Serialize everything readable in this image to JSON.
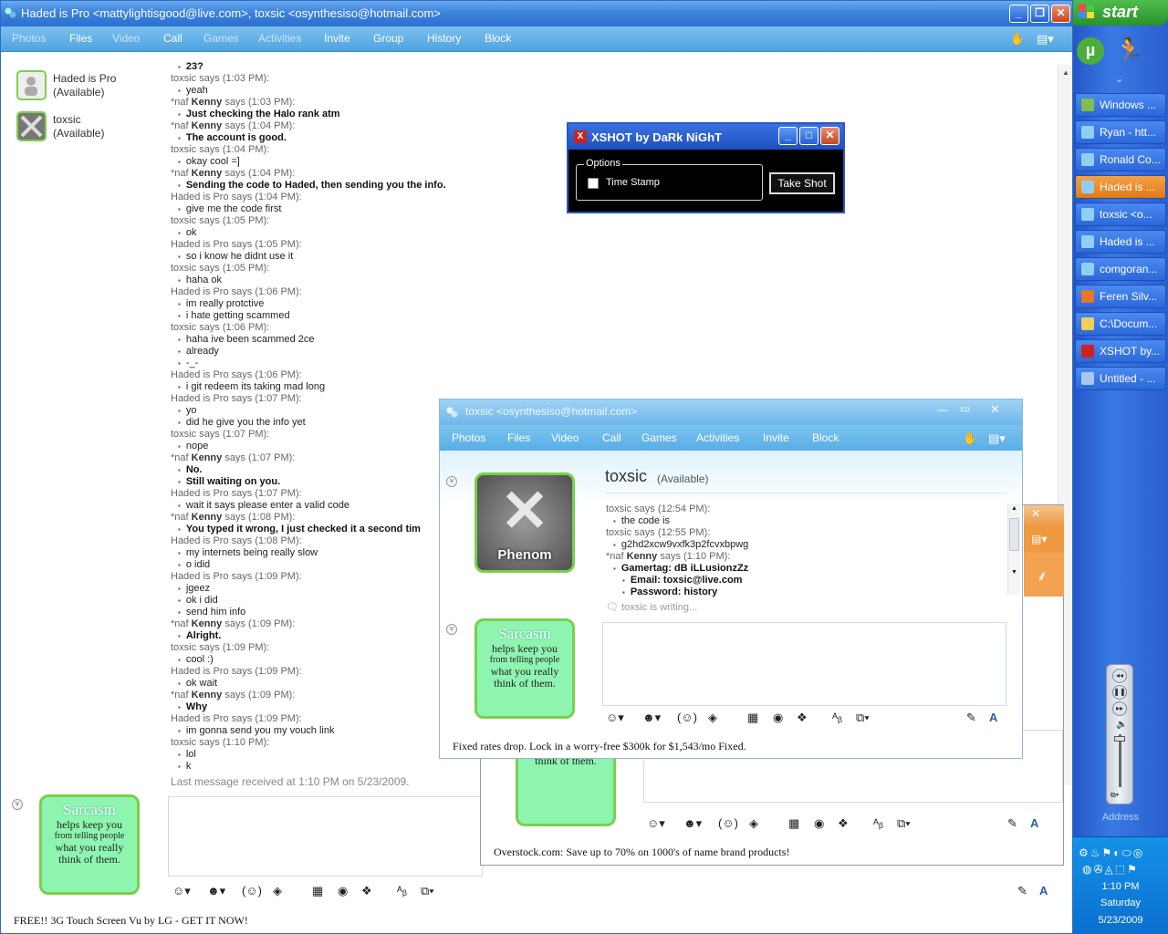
{
  "main_window": {
    "title": "Haded is Pro <mattylightisgood@live.com>, toxsic <osynthesiso@hotmail.com>",
    "menu": [
      {
        "label": "Photos",
        "dim": true
      },
      {
        "label": "Files",
        "dim": false
      },
      {
        "label": "Video",
        "dim": true
      },
      {
        "label": "Call",
        "dim": false
      },
      {
        "label": "Games",
        "dim": true
      },
      {
        "label": "Activities",
        "dim": true
      },
      {
        "label": "Invite",
        "dim": false
      },
      {
        "label": "Group",
        "dim": false
      },
      {
        "label": "History",
        "dim": false
      },
      {
        "label": "Block",
        "dim": false
      }
    ],
    "contacts": [
      {
        "name": "Haded is Pro",
        "status": "(Available)"
      },
      {
        "name": "toxsic",
        "status": "(Available)"
      }
    ],
    "messages": [
      {
        "lines": [
          "23?"
        ],
        "bold": true
      },
      {
        "sender": "toxsic",
        "prefix": "",
        "time": "says (1:03 PM):",
        "lines": [
          "yeah"
        ]
      },
      {
        "sender": "Kenny",
        "prefix": "*naf ",
        "time": "says (1:03 PM):",
        "lines": [
          "Just checking the Halo rank atm"
        ],
        "bold": true
      },
      {
        "sender": "Kenny",
        "prefix": "*naf ",
        "time": "says (1:04 PM):",
        "lines": [
          "The account is good."
        ],
        "bold": true
      },
      {
        "sender": "toxsic",
        "prefix": "",
        "time": "says (1:04 PM):",
        "lines": [
          "okay cool =]"
        ]
      },
      {
        "sender": "Kenny",
        "prefix": "*naf ",
        "time": "says (1:04 PM):",
        "lines": [
          "Sending the code to Haded, then sending you the info."
        ],
        "bold": true
      },
      {
        "sender": "Haded is Pro",
        "prefix": "",
        "time": "says (1:04 PM):",
        "lines": [
          "give me the code first"
        ]
      },
      {
        "sender": "toxsic",
        "prefix": "",
        "time": "says (1:05 PM):",
        "lines": [
          "ok"
        ]
      },
      {
        "sender": "Haded is Pro",
        "prefix": "",
        "time": "says (1:05 PM):",
        "lines": [
          "so i know he didnt use it"
        ]
      },
      {
        "sender": "toxsic",
        "prefix": "",
        "time": "says (1:05 PM):",
        "lines": [
          "haha ok"
        ]
      },
      {
        "sender": "Haded is Pro",
        "prefix": "",
        "time": "says (1:06 PM):",
        "lines": [
          "im really protctive",
          "i hate getting scammed"
        ]
      },
      {
        "sender": "toxsic",
        "prefix": "",
        "time": "says (1:06 PM):",
        "lines": [
          "haha ive been scammed 2ce",
          "already",
          "-_-"
        ]
      },
      {
        "sender": "Haded is Pro",
        "prefix": "",
        "time": "says (1:06 PM):",
        "lines": [
          "i git redeem its taking mad long"
        ]
      },
      {
        "sender": "Haded is Pro",
        "prefix": "",
        "time": "says (1:07 PM):",
        "lines": [
          "yo",
          "did he give you the info yet"
        ]
      },
      {
        "sender": "toxsic",
        "prefix": "",
        "time": "says (1:07 PM):",
        "lines": [
          "nope"
        ]
      },
      {
        "sender": "Kenny",
        "prefix": "*naf ",
        "time": "says (1:07 PM):",
        "lines": [
          "No.",
          "Still waiting on you."
        ],
        "bold": true
      },
      {
        "sender": "Haded is Pro",
        "prefix": "",
        "time": "says (1:07 PM):",
        "lines": [
          "wait it says please enter a valid code"
        ]
      },
      {
        "sender": "Kenny",
        "prefix": "*naf ",
        "time": "says (1:08 PM):",
        "lines": [
          "You typed it wrong, I just checked it a second tim"
        ],
        "bold": true
      },
      {
        "sender": "Haded is Pro",
        "prefix": "",
        "time": "says (1:08 PM):",
        "lines": [
          "my internets being really slow",
          "o idid"
        ]
      },
      {
        "sender": "Haded is Pro",
        "prefix": "",
        "time": "says (1:09 PM):",
        "lines": [
          "jgeez",
          "ok i did",
          "send him info"
        ]
      },
      {
        "sender": "Kenny",
        "prefix": "*naf ",
        "time": "says (1:09 PM):",
        "lines": [
          "Alright."
        ],
        "bold": true
      },
      {
        "sender": "toxsic",
        "prefix": "",
        "time": "says (1:09 PM):",
        "lines": [
          "cool :)"
        ]
      },
      {
        "sender": "Haded is Pro",
        "prefix": "",
        "time": "says (1:09 PM):",
        "lines": [
          "ok wait"
        ]
      },
      {
        "sender": "Kenny",
        "prefix": "*naf ",
        "time": "says (1:09 PM):",
        "lines": [
          "Why"
        ],
        "bold": true
      },
      {
        "sender": "Haded is Pro",
        "prefix": "",
        "time": "says (1:09 PM):",
        "lines": [
          "im gonna send you my vouch link"
        ]
      },
      {
        "sender": "toxsic",
        "prefix": "",
        "time": "says (1:10 PM):",
        "lines": [
          "lol",
          "k"
        ]
      }
    ],
    "last_message": "Last message received at 1:10 PM on 5/23/2009.",
    "ad": "FREE!! 3G Touch Screen Vu by LG - GET IT NOW!"
  },
  "avatar_text": {
    "title": "Sarcasm",
    "line1": "helps keep you",
    "line2": "from telling people",
    "line3": "what you really",
    "line4": "think of them."
  },
  "xshot": {
    "title": "XSHOT by DaRk NiGhT",
    "group_label": "Options",
    "checkbox_label": "Time Stamp",
    "button": "Take Shot"
  },
  "front_window": {
    "title": "toxsic <osynthesiso@hotmail.com>",
    "menu": [
      "Photos",
      "Files",
      "Video",
      "Call",
      "Games",
      "Activities",
      "Invite",
      "Block"
    ],
    "contact_name": "toxsic",
    "contact_status": "(Available)",
    "avatar_label": "Phenom",
    "messages": [
      {
        "hdr": "toxsic says (12:54 PM):",
        "lines": [
          "the code is"
        ],
        "bold": false
      },
      {
        "hdr": "toxsic says (12:55 PM):",
        "lines": [
          "g2hd2xcw9vxfk3p2fcvxbpwg"
        ],
        "bold": false
      },
      {
        "hdr_prefix": "*naf ",
        "hdr_name": "Kenny",
        "hdr_time": " says (1:10 PM):",
        "lines": [
          "Gamertag: dB iLLusionzZz",
          "Email: toxsic@live.com",
          "Password: history"
        ],
        "bold": true
      }
    ],
    "typing": "toxsic is writing...",
    "ad": "Fixed rates drop. Lock in a worry-free $300k for $1,543/mo Fixed."
  },
  "back_window": {
    "ad": "Overstock.com: Save up to 70% on 1000's of name brand products!"
  },
  "taskbar": {
    "start": "start",
    "items": [
      {
        "label": "Windows ...",
        "active": false,
        "icon_color": "#7fbf4a"
      },
      {
        "label": "Ryan - htt...",
        "active": false,
        "icon_color": "#8fd0f0"
      },
      {
        "label": "Ronald Co...",
        "active": false,
        "icon_color": "#8fd0f0"
      },
      {
        "label": "Haded is ...",
        "active": true,
        "icon_color": "#8fd0f0"
      },
      {
        "label": "toxsic <o...",
        "active": false,
        "icon_color": "#8fd0f0"
      },
      {
        "label": "Haded is ...",
        "active": false,
        "icon_color": "#8fd0f0"
      },
      {
        "label": "comgoran...",
        "active": false,
        "icon_color": "#8fd0f0"
      },
      {
        "label": "Feren Silv...",
        "active": false,
        "icon_color": "#e8772a"
      },
      {
        "label": "C:\\Docum...",
        "active": false,
        "icon_color": "#f2cf58"
      },
      {
        "label": "XSHOT by...",
        "active": false,
        "icon_color": "#c22"
      },
      {
        "label": "Untitled - ...",
        "active": false,
        "icon_color": "#a8c8f0"
      }
    ],
    "address_label": "Address",
    "clock": "1:10 PM",
    "day": "Saturday",
    "date": "5/23/2009"
  },
  "colors": {
    "accent": "#4fa3e2",
    "avatar_border": "#78d04a",
    "taskbar": "#2a5fcf",
    "active_task": "#e07a16"
  }
}
